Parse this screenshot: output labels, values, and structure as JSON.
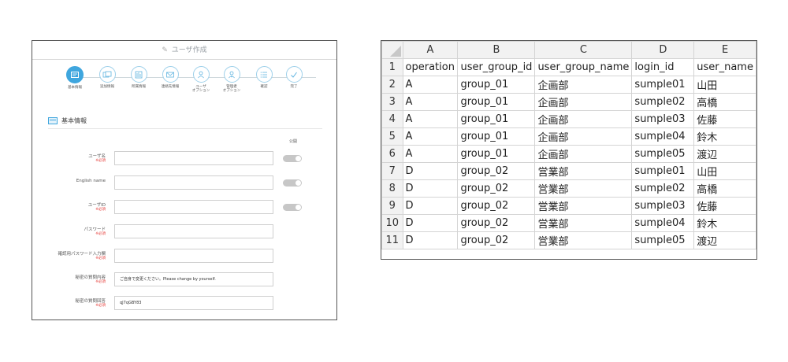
{
  "form": {
    "title": "ユーザ作成",
    "steps": [
      {
        "label": "基本情報",
        "icon": "card-icon",
        "active": true
      },
      {
        "label": "追加情報",
        "icon": "cards-icon",
        "active": false
      },
      {
        "label": "所属情報",
        "icon": "building-icon",
        "active": false
      },
      {
        "label": "連絡先情報",
        "icon": "mail-icon",
        "active": false
      },
      {
        "label": "ユーザ\nオプション",
        "icon": "user-icon",
        "active": false
      },
      {
        "label": "管理者\nオプション",
        "icon": "admin-icon",
        "active": false
      },
      {
        "label": "確認",
        "icon": "list-icon",
        "active": false
      },
      {
        "label": "完了",
        "icon": "check-icon",
        "active": false
      }
    ],
    "section_title": "基本情報",
    "public_label": "公開",
    "required_mark": "※必須",
    "fields": [
      {
        "label": "ユーザ名",
        "required": true,
        "value": "",
        "toggle": true
      },
      {
        "label": "English name",
        "required": false,
        "value": "",
        "toggle": true
      },
      {
        "label": "ユーザID",
        "required": true,
        "value": "",
        "toggle": true
      },
      {
        "label": "パスワード",
        "required": true,
        "value": "",
        "toggle": false
      },
      {
        "label": "確認用パスワード入力欄",
        "required": true,
        "value": "",
        "toggle": false
      },
      {
        "label": "秘密の質問内容",
        "required": true,
        "value": "ご自身で変更ください。Please change by yourself.",
        "toggle": false
      },
      {
        "label": "秘密の質問回答",
        "required": true,
        "value": "qJ7qGBY83",
        "toggle": false
      }
    ]
  },
  "sheet": {
    "columns": [
      "A",
      "B",
      "C",
      "D",
      "E"
    ],
    "rows": [
      [
        "operation",
        "user_group_id",
        "user_group_name",
        "login_id",
        "user_name"
      ],
      [
        "A",
        "group_01",
        "企画部",
        "sumple01",
        "山田"
      ],
      [
        "A",
        "group_01",
        "企画部",
        "sumple02",
        "高橋"
      ],
      [
        "A",
        "group_01",
        "企画部",
        "sumple03",
        "佐藤"
      ],
      [
        "A",
        "group_01",
        "企画部",
        "sumple04",
        "鈴木"
      ],
      [
        "A",
        "group_01",
        "企画部",
        "sumple05",
        "渡辺"
      ],
      [
        "D",
        "group_02",
        "営業部",
        "sumple01",
        "山田"
      ],
      [
        "D",
        "group_02",
        "営業部",
        "sumple02",
        "高橋"
      ],
      [
        "D",
        "group_02",
        "営業部",
        "sumple03",
        "佐藤"
      ],
      [
        "D",
        "group_02",
        "営業部",
        "sumple04",
        "鈴木"
      ],
      [
        "D",
        "group_02",
        "営業部",
        "sumple05",
        "渡辺"
      ]
    ]
  },
  "colors": {
    "accent": "#3fa6de",
    "required": "#e53935"
  }
}
